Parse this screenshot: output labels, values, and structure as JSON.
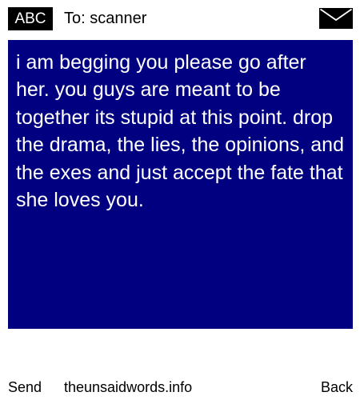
{
  "header": {
    "input_mode": "ABC",
    "to_line": "To: scanner",
    "envelope_icon": "envelope-icon"
  },
  "message": {
    "text": "i am begging you please go after her. you guys are meant to be together its stupid at this point. drop the drama, the lies, the opinions, and the exes and just accept the fate that she loves you.",
    "background_color": "#000080",
    "text_color": "#ffffff"
  },
  "footer": {
    "send_label": "Send",
    "site_label": "theunsaidwords.info",
    "back_label": "Back"
  }
}
